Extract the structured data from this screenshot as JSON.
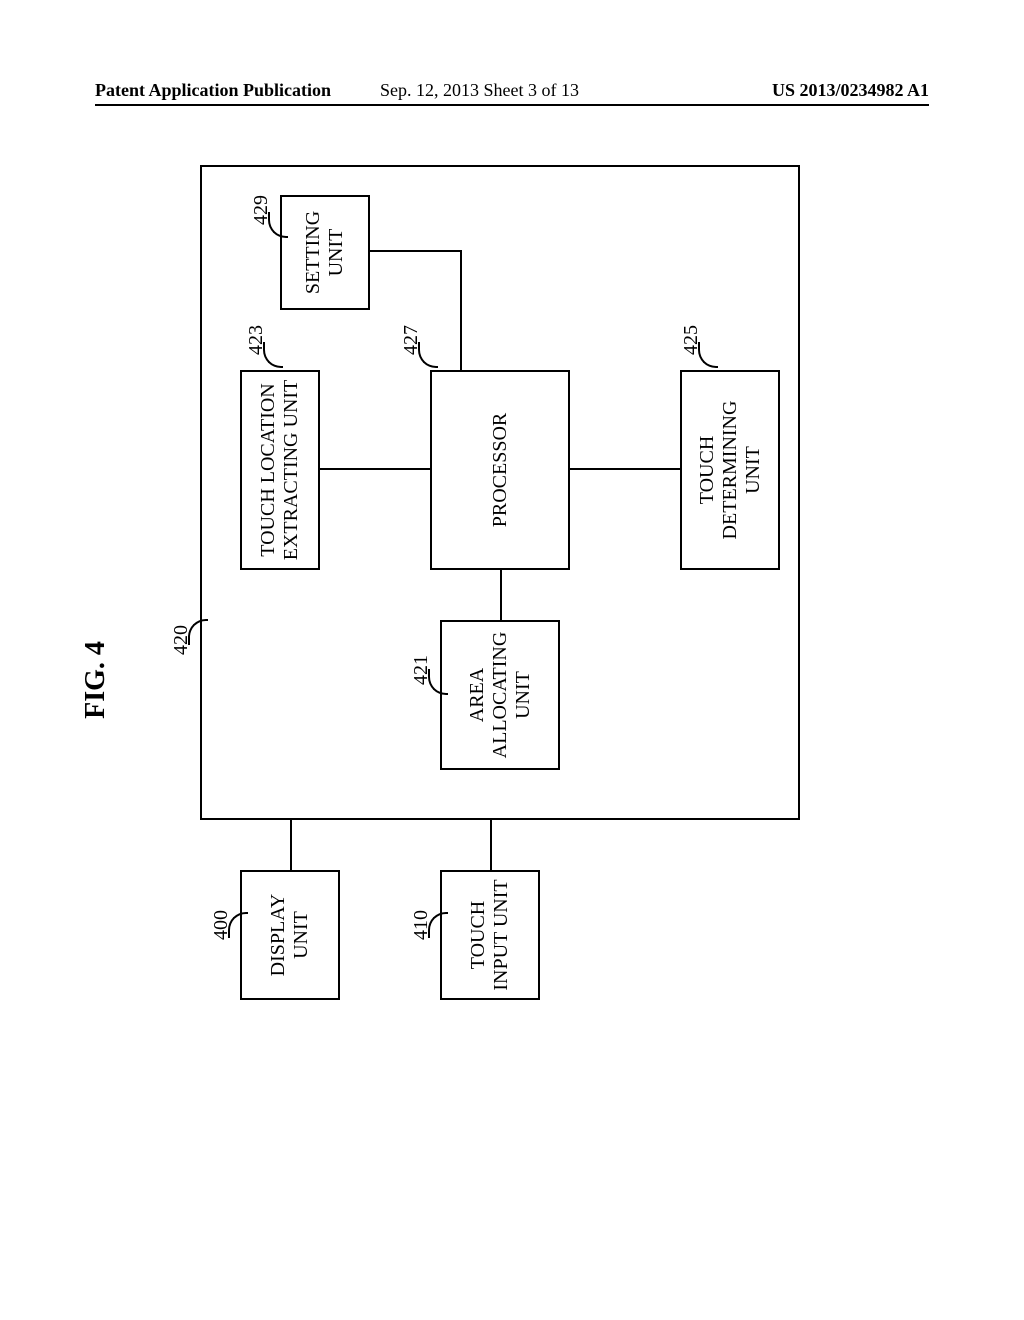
{
  "header": {
    "left": "Patent Application Publication",
    "center": "Sep. 12, 2013  Sheet 3 of 13",
    "right": "US 2013/0234982 A1"
  },
  "figure": {
    "title": "FIG. 4",
    "refs": {
      "display_unit": "400",
      "touch_input": "410",
      "main": "420",
      "area_alloc": "421",
      "touch_loc": "423",
      "touch_det": "425",
      "processor": "427",
      "setting": "429"
    },
    "blocks": {
      "display_unit": "DISPLAY\nUNIT",
      "touch_input": "TOUCH\nINPUT UNIT",
      "area_alloc": "AREA\nALLOCATING\nUNIT",
      "touch_loc": "TOUCH LOCATION\nEXTRACTING UNIT",
      "processor": "PROCESSOR",
      "touch_det": "TOUCH\nDETERMINING\nUNIT",
      "setting": "SETTING\nUNIT"
    }
  }
}
